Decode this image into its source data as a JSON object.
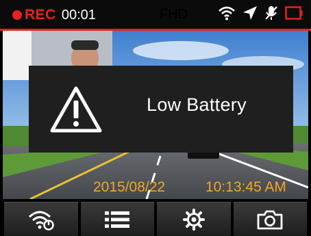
{
  "status_bar": {
    "rec_label": "REC",
    "rec_time": "00:01",
    "resolution": "FHD",
    "icons": [
      "wifi-icon",
      "gps-arrow-icon",
      "mic-muted-icon",
      "battery-empty-icon"
    ]
  },
  "dialog": {
    "icon": "warning-icon",
    "message": "Low Battery"
  },
  "overlay": {
    "date": "2015/08/22",
    "time": "10:13:45 AM"
  },
  "toolbar": {
    "buttons": [
      "wifi-settings-icon",
      "menu-list-icon",
      "settings-gear-icon",
      "camera-icon"
    ]
  },
  "colors": {
    "rec_red": "#e8211c",
    "timestamp_orange": "#f5a623",
    "dialog_bg": "#1f1f1f"
  }
}
